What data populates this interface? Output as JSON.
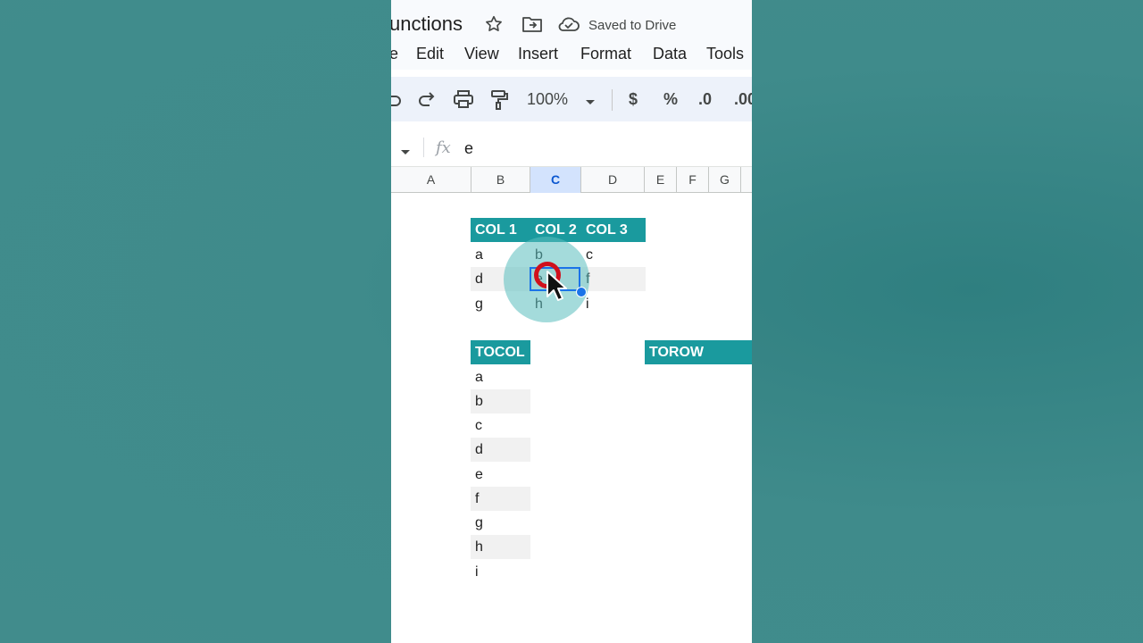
{
  "title_bar": {
    "doc_title": "unctions",
    "saved_status": "Saved to Drive"
  },
  "menu": {
    "items": [
      "e",
      "Edit",
      "View",
      "Insert",
      "Format",
      "Data",
      "Tools"
    ]
  },
  "toolbar": {
    "zoom": "100%",
    "currency": "$",
    "percent": "%",
    "decrease_decimal": ".0",
    "increase_decimal": ".00"
  },
  "formula_bar": {
    "fx_label": "fx",
    "value": "e"
  },
  "columns": [
    "A",
    "B",
    "C",
    "D",
    "E",
    "F",
    "G"
  ],
  "selected_column": "C",
  "table": {
    "headers": [
      "COL 1",
      "COL 2",
      "COL 3"
    ],
    "rows": [
      [
        "a",
        "b",
        "c"
      ],
      [
        "d",
        "e",
        "f"
      ],
      [
        "g",
        "h",
        "i"
      ]
    ]
  },
  "tocol": {
    "header": "TOCOL",
    "values": [
      "a",
      "b",
      "c",
      "d",
      "e",
      "f",
      "g",
      "h",
      "i"
    ]
  },
  "torow": {
    "header": "TOROW"
  },
  "colors": {
    "header_teal": "#1a9a9e",
    "selection_blue": "#1a73e8",
    "cursor_ring_red": "#d0101c",
    "background_teal": "#3f8b8b"
  }
}
